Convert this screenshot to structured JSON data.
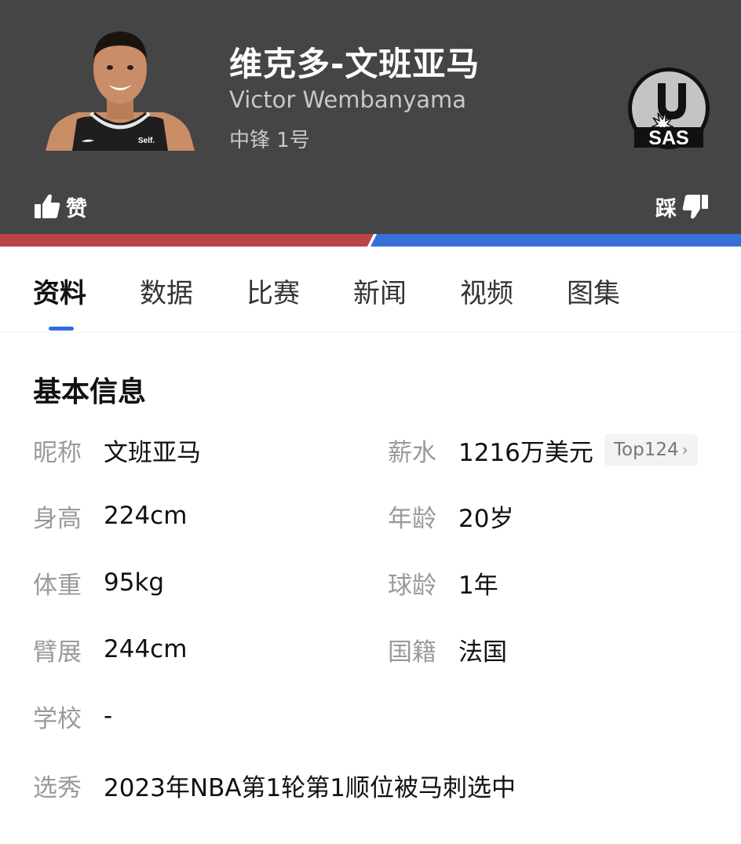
{
  "player": {
    "name_cn": "维克多-文班亚马",
    "name_en": "Victor Wembanyama",
    "position": "中锋 1号",
    "jersey_sponsor": "Self."
  },
  "team": {
    "abbr": "SAS",
    "logo_icon": "spurs-logo-icon"
  },
  "vote": {
    "like_label": "赞",
    "dislike_label": "踩",
    "like_color": "#b94545",
    "dislike_color": "#3b6fd8"
  },
  "tabs": [
    "资料",
    "数据",
    "比赛",
    "新闻",
    "视频",
    "图集"
  ],
  "basic_info": {
    "title": "基本信息",
    "fields": {
      "nickname": {
        "label": "昵称",
        "value": "文班亚马"
      },
      "height": {
        "label": "身高",
        "value": "224cm"
      },
      "weight": {
        "label": "体重",
        "value": "95kg"
      },
      "wingspan": {
        "label": "臂展",
        "value": "244cm"
      },
      "school": {
        "label": "学校",
        "value": "-"
      },
      "draft": {
        "label": "选秀",
        "value": "2023年NBA第1轮第1顺位被马刺选中"
      },
      "salary": {
        "label": "薪水",
        "value": "1216万美元",
        "rank_badge": "Top124"
      },
      "age": {
        "label": "年龄",
        "value": "20岁"
      },
      "experience": {
        "label": "球龄",
        "value": "1年"
      },
      "nationality": {
        "label": "国籍",
        "value": "法国"
      }
    }
  },
  "colors": {
    "header_bg": "#454545",
    "accent_blue": "#2f6fe0"
  }
}
